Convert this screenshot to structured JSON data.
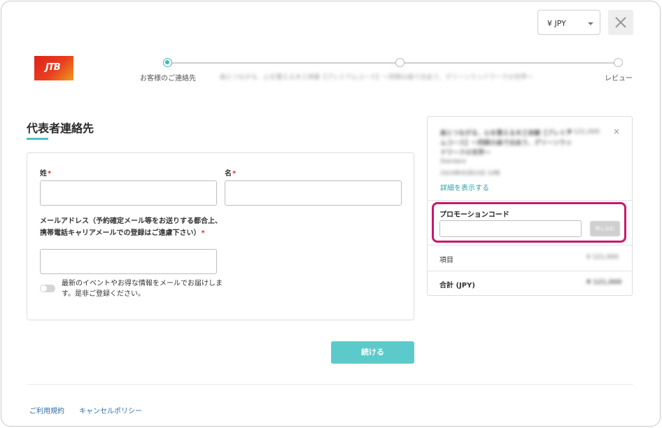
{
  "header": {
    "currency": "¥ JPY",
    "logo_text": "JTB"
  },
  "stepper": {
    "steps": [
      {
        "label": "お客様のご連絡先",
        "state": "active"
      },
      {
        "label": "森とつながる、心を整える木工体験【プレミアムコース】〜同期の森で出会う、グリーンウッドワークの世界〜",
        "state": "inactive"
      },
      {
        "label": "レビュー",
        "state": "inactive"
      }
    ]
  },
  "section": {
    "title": "代表者連絡先"
  },
  "form": {
    "last_name_label": "姓",
    "first_name_label": "名",
    "required_mark": "*",
    "email_label": "メールアドレス（予約確定メール等をお送りする都合上、携帯電話キャリアメールでの登録はご遠慮下さい）",
    "newsletter_text": "最新のイベントやお得な情報をメールでお届けします。是非ご登録ください。",
    "newsletter_on": false,
    "continue_label": "続ける"
  },
  "summary": {
    "product_title": "森とつながる、心を整える木工体験【プレミアムコース】〜同期の森で出会う、グリーンウッドワークの世界〜",
    "product_price": "¥ 121,000",
    "product_plan": "Standard",
    "product_date": "2024年05月03日 10時",
    "details_link": "詳細を表示する",
    "promo_label": "プロモーションコード",
    "promo_apply": "申し込む",
    "items_label": "項目",
    "items_value": "¥ 121,000",
    "total_label": "合計 (JPY)",
    "total_value": "¥ 121,000",
    "highlight_color": "#c8186a"
  },
  "footer": {
    "terms": "ご利用規約",
    "cancel_policy": "キャンセルポリシー"
  },
  "colors": {
    "accent": "#4cc2c2",
    "link": "#2f6fa8"
  }
}
